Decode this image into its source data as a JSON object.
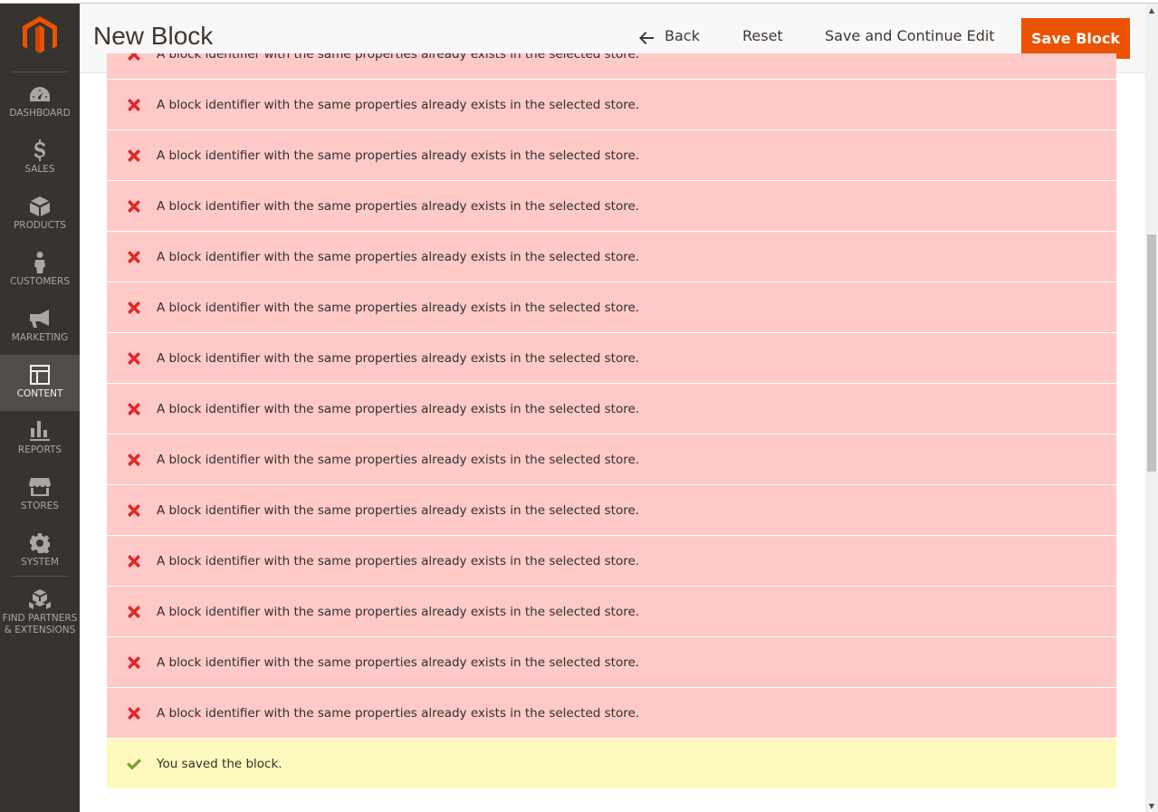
{
  "header": {
    "title": "New Block",
    "back_label": "Back",
    "reset_label": "Reset",
    "save_continue_label": "Save and Continue Edit",
    "save_label": "Save Block"
  },
  "sidebar": {
    "items": [
      {
        "label": "DASHBOARD",
        "icon": "dashboard-icon"
      },
      {
        "label": "SALES",
        "icon": "dollar-icon"
      },
      {
        "label": "PRODUCTS",
        "icon": "cube-icon"
      },
      {
        "label": "CUSTOMERS",
        "icon": "person-icon"
      },
      {
        "label": "MARKETING",
        "icon": "megaphone-icon"
      },
      {
        "label": "CONTENT",
        "icon": "layout-icon",
        "active": true
      },
      {
        "label": "REPORTS",
        "icon": "bar-chart-icon"
      },
      {
        "label": "STORES",
        "icon": "storefront-icon"
      },
      {
        "label": "SYSTEM",
        "icon": "gear-icon"
      },
      {
        "label": "FIND PARTNERS & EXTENSIONS",
        "icon": "cubes-icon"
      }
    ]
  },
  "messages": {
    "errors": [
      "A block identifier with the same properties already exists in the selected store.",
      "A block identifier with the same properties already exists in the selected store.",
      "A block identifier with the same properties already exists in the selected store.",
      "A block identifier with the same properties already exists in the selected store.",
      "A block identifier with the same properties already exists in the selected store.",
      "A block identifier with the same properties already exists in the selected store.",
      "A block identifier with the same properties already exists in the selected store.",
      "A block identifier with the same properties already exists in the selected store.",
      "A block identifier with the same properties already exists in the selected store.",
      "A block identifier with the same properties already exists in the selected store.",
      "A block identifier with the same properties already exists in the selected store.",
      "A block identifier with the same properties already exists in the selected store.",
      "A block identifier with the same properties already exists in the selected store.",
      "A block identifier with the same properties already exists in the selected store."
    ],
    "success": "You saved the block."
  },
  "colors": {
    "sidebar_bg": "#373330",
    "accent": "#eb5202",
    "error_bg": "#fec9c7",
    "error_icon": "#e22626",
    "success_bg": "#fdf9be",
    "success_icon": "#79a22e"
  }
}
